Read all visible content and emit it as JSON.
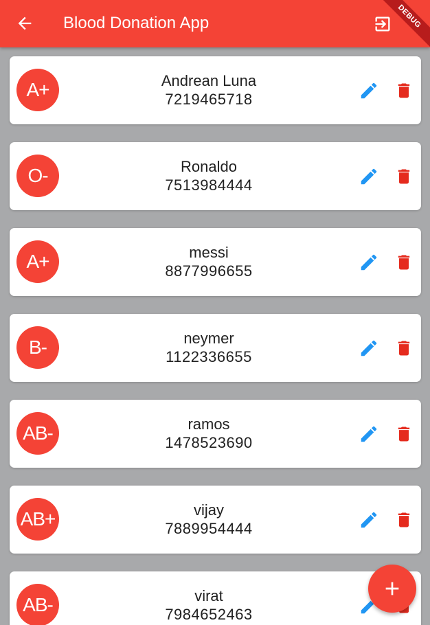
{
  "appbar": {
    "title": "Blood Donation App",
    "debug_label": "DEBUG",
    "back_icon": "arrow-back-icon",
    "logout_icon": "logout-icon"
  },
  "colors": {
    "primary": "#f44336",
    "edit": "#2196f3",
    "delete": "#e52b1e",
    "background": "#a8a9ab"
  },
  "donors": [
    {
      "blood_group": "A+",
      "name": "Andrean Luna",
      "phone": "7219465718"
    },
    {
      "blood_group": "O-",
      "name": "Ronaldo",
      "phone": "7513984444"
    },
    {
      "blood_group": "A+",
      "name": "messi",
      "phone": "8877996655"
    },
    {
      "blood_group": "B-",
      "name": "neymer",
      "phone": "1122336655"
    },
    {
      "blood_group": "AB-",
      "name": "ramos",
      "phone": "1478523690"
    },
    {
      "blood_group": "AB+",
      "name": "vijay",
      "phone": "7889954444"
    },
    {
      "blood_group": "AB-",
      "name": "virat",
      "phone": "7984652463"
    }
  ],
  "fab": {
    "icon": "add-icon"
  }
}
